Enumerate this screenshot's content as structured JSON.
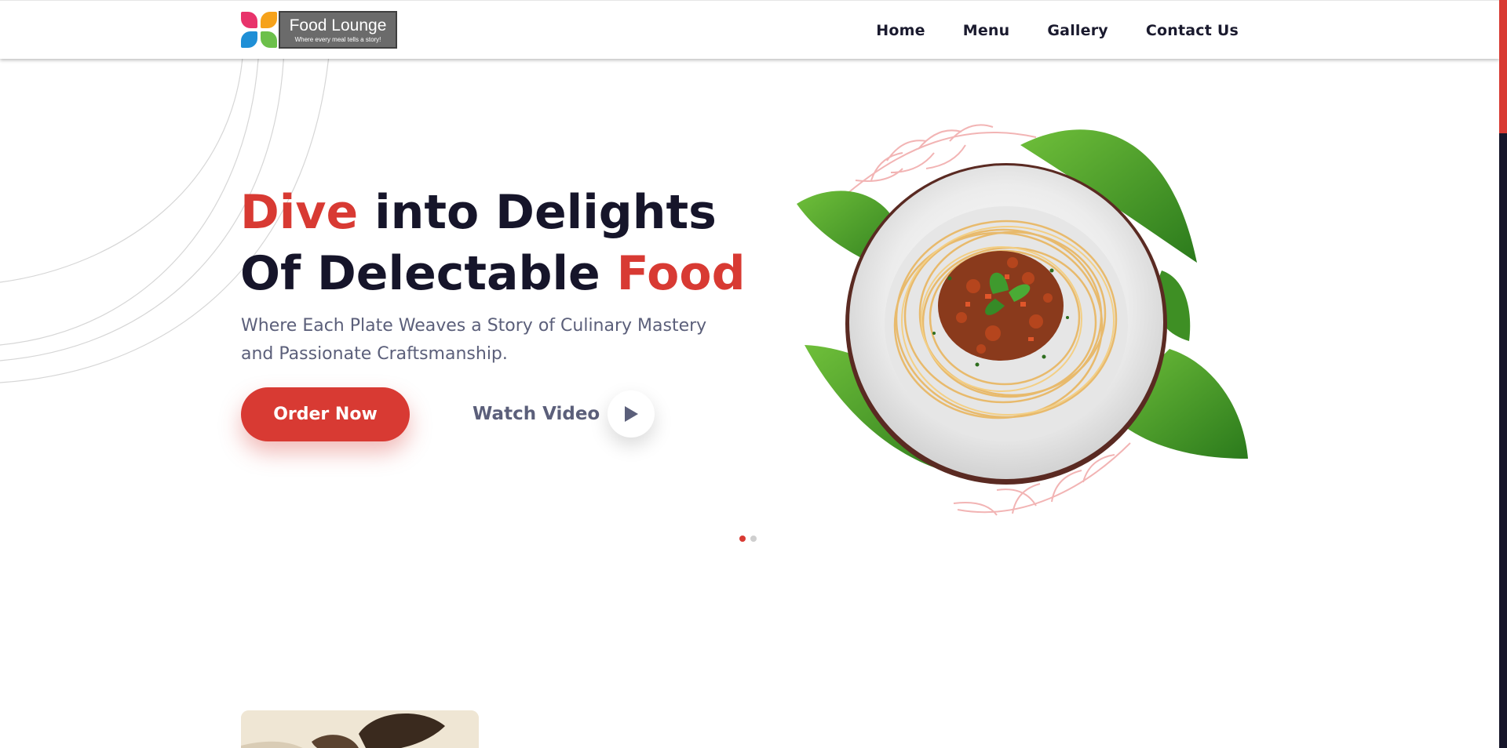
{
  "header": {
    "logo": {
      "name": "Food Lounge",
      "tagline": "Where every meal tells a story!"
    },
    "nav": [
      {
        "label": "Home"
      },
      {
        "label": "Menu"
      },
      {
        "label": "Gallery"
      },
      {
        "label": "Contact Us"
      }
    ]
  },
  "hero": {
    "title_line1_accent": "Dive",
    "title_line1_rest": " into Delights",
    "title_line2_rest": "Of Delectable ",
    "title_line2_accent": "Food",
    "subtitle_line1": "Where Each Plate Weaves a Story of Culinary Mastery",
    "subtitle_line2": "and Passionate Craftsmanship.",
    "order_button": "Order Now",
    "watch_video": "Watch Video",
    "slider": {
      "total_slides": 2,
      "active_slide": 1
    }
  },
  "colors": {
    "accent": "#d83a33",
    "heading": "#16152a",
    "muted_text": "#5b5f7a",
    "scrollbar_track": "#17162a"
  },
  "icons": [
    "logo-mark-icon",
    "play-icon",
    "spaghetti-dish-image"
  ]
}
